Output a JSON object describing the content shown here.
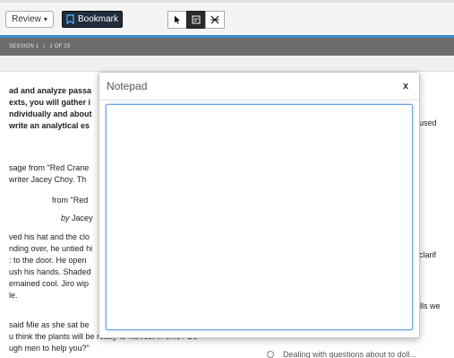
{
  "toolbar": {
    "review_label": "Review",
    "review_arrow": "▾",
    "bookmark_label": "Bookmark",
    "tools": [
      {
        "name": "pointer-tool-icon"
      },
      {
        "name": "notepad-tool-icon"
      },
      {
        "name": "line-reader-tool-icon"
      }
    ]
  },
  "session_bar": {
    "session": "SESSION 1",
    "separator": "/",
    "page": "1 OF 23"
  },
  "passage": {
    "bold_lines": [
      "ad and analyze passa",
      "exts, you will gather i",
      "ndividually and about",
      " write an analytical es"
    ],
    "intro_lines": [
      "sage from \"Red Crane",
      " writer Jacey Choy. Th"
    ],
    "title_line": "from \"Red",
    "author_by": "by",
    "author_name": "Jacey",
    "story_lines": [
      "ved his hat and the clo",
      "nding over, he untied hi",
      ": to the door. He open",
      "ush his hands. Shaded",
      "emained cool. Jiro wip",
      "le."
    ],
    "dialog_lines": [
      "said Mie as she sat be",
      "u think the plants will be ready to harvest in time? Do",
      "ugh men to help you?\""
    ]
  },
  "questions": {
    "fragments": [
      "t is used",
      "lps clarif",
      "r calls we"
    ],
    "bottom_option": "Dealing with questions about to doll..."
  },
  "notepad": {
    "title": "Notepad",
    "close_label": "x",
    "value": "",
    "placeholder": ""
  },
  "colors": {
    "accent_blue": "#3a8fd8",
    "session_bar": "#6b6b6b",
    "bookmark_bg": "#1f2d3d"
  }
}
